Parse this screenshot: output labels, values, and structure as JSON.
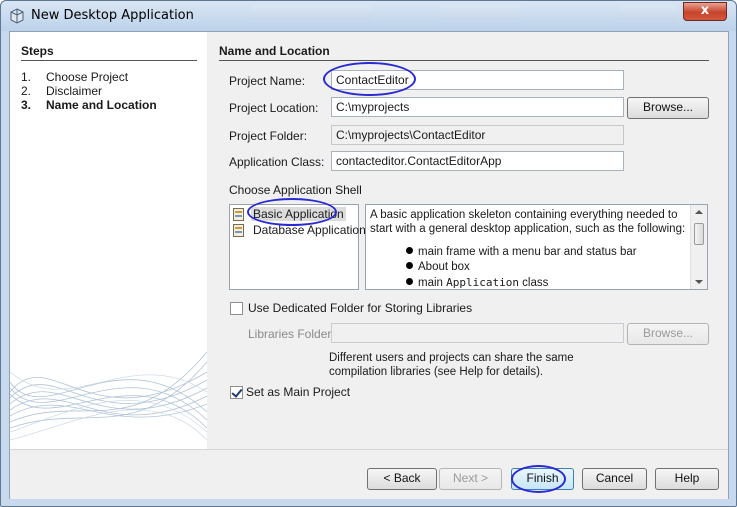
{
  "window": {
    "title": "New Desktop Application",
    "close_glyph": "x"
  },
  "steps": {
    "heading": "Steps",
    "items": [
      {
        "num": "1.",
        "label": "Choose Project"
      },
      {
        "num": "2.",
        "label": "Disclaimer"
      },
      {
        "num": "3.",
        "label": "Name and Location"
      }
    ]
  },
  "panel": {
    "heading": "Name and Location",
    "project_name_label": "Project Name:",
    "project_name_value": "ContactEditor",
    "project_location_label": "Project Location:",
    "project_location_value": "C:\\myprojects",
    "browse_label": "Browse...",
    "project_folder_label": "Project Folder:",
    "project_folder_value": "C:\\myprojects\\ContactEditor",
    "application_class_label": "Application Class:",
    "application_class_value": "contacteditor.ContactEditorApp",
    "shell_label": "Choose Application Shell",
    "shells": [
      "Basic Application",
      "Database Application"
    ],
    "selected_shell": "Basic Application",
    "description": "A basic application skeleton containing everything needed to start with a general desktop application, such as the following:",
    "description_bullets": [
      {
        "text": "main frame with a menu bar and status bar"
      },
      {
        "text": "About box"
      },
      {
        "prefix": "main ",
        "code": "Application",
        "suffix": " class"
      }
    ],
    "dedicated_folder_label": "Use Dedicated Folder for Storing Libraries",
    "dedicated_folder_checked": false,
    "libraries_folder_label": "Libraries Folder:",
    "libraries_folder_value": "",
    "libraries_browse_label": "Browse...",
    "libraries_note": "Different users and projects can share the same compilation libraries (see Help for details).",
    "main_project_label": "Set as Main Project",
    "main_project_checked": true
  },
  "buttons": {
    "back": "< Back",
    "next": "Next >",
    "finish": "Finish",
    "cancel": "Cancel",
    "help": "Help"
  },
  "colors": {
    "annotation": "#2a2ad4",
    "title_bar": "#c8d9ee"
  }
}
